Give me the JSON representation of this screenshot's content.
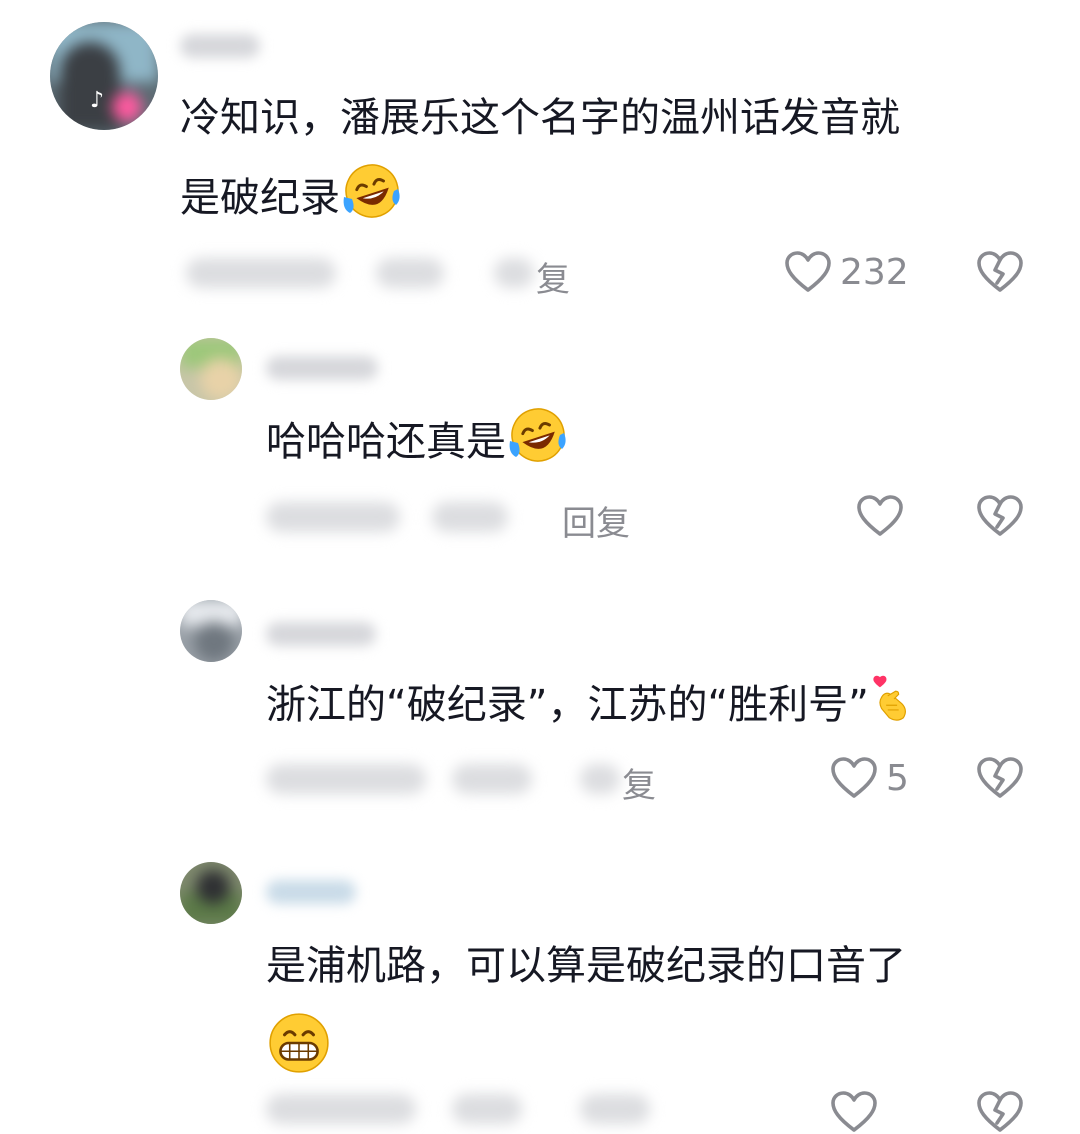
{
  "comments": [
    {
      "text": "冷知识，潘展乐这个名字的温州话发音就",
      "text_line2": "是破纪录",
      "emoji": "laughing-crying-emoji",
      "reply_label": "复",
      "like_count": "232"
    },
    {
      "text": "哈哈哈还真是",
      "emoji": "laughing-crying-emoji",
      "reply_label": "回复",
      "like_count": ""
    },
    {
      "text": "浙江的“破纪录”，江苏的“胜利号”",
      "emoji": "finger-heart-emoji",
      "reply_label": "复",
      "like_count": "5"
    },
    {
      "text": "是浦机路，可以算是破纪录的口音了",
      "emoji": "grinning-emoji",
      "reply_label": "",
      "like_count": ""
    }
  ],
  "icons": {
    "like": "heart-outline-icon",
    "dislike": "broken-heart-icon"
  },
  "colors": {
    "text": "#161823",
    "secondary": "#8a8b91",
    "background": "#ffffff"
  }
}
